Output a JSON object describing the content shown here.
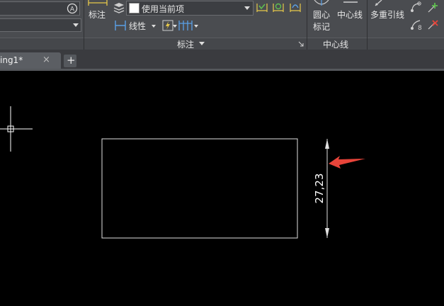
{
  "ribbon": {
    "dimension_button": {
      "label": "标注"
    },
    "dimstyle_combo": {
      "value": "使用当前项"
    },
    "linear_dropdown": {
      "label": "线性"
    },
    "panel_title_annotate": "标注",
    "centermark_button": {
      "label_line1": "圆心",
      "label_line2": "标记"
    },
    "centerline_button": {
      "label": "中心线"
    },
    "panel_title_centerline": "中心线",
    "multileader_button": {
      "label": "多重引线"
    }
  },
  "tabs": [
    {
      "label": "ing1*",
      "close": "×"
    }
  ],
  "new_tab_symbol": "+",
  "drawing": {
    "dimension_text": "27,23"
  },
  "colors": {
    "ribbon_bg": "#4a4c50",
    "canvas_bg": "#000000",
    "geometry": "#e0e0e0",
    "arrow_annotation": "#e8443a",
    "icon_yellow": "#e6c84a",
    "icon_green": "#5fbf4f",
    "icon_blue": "#5aa0e6"
  }
}
